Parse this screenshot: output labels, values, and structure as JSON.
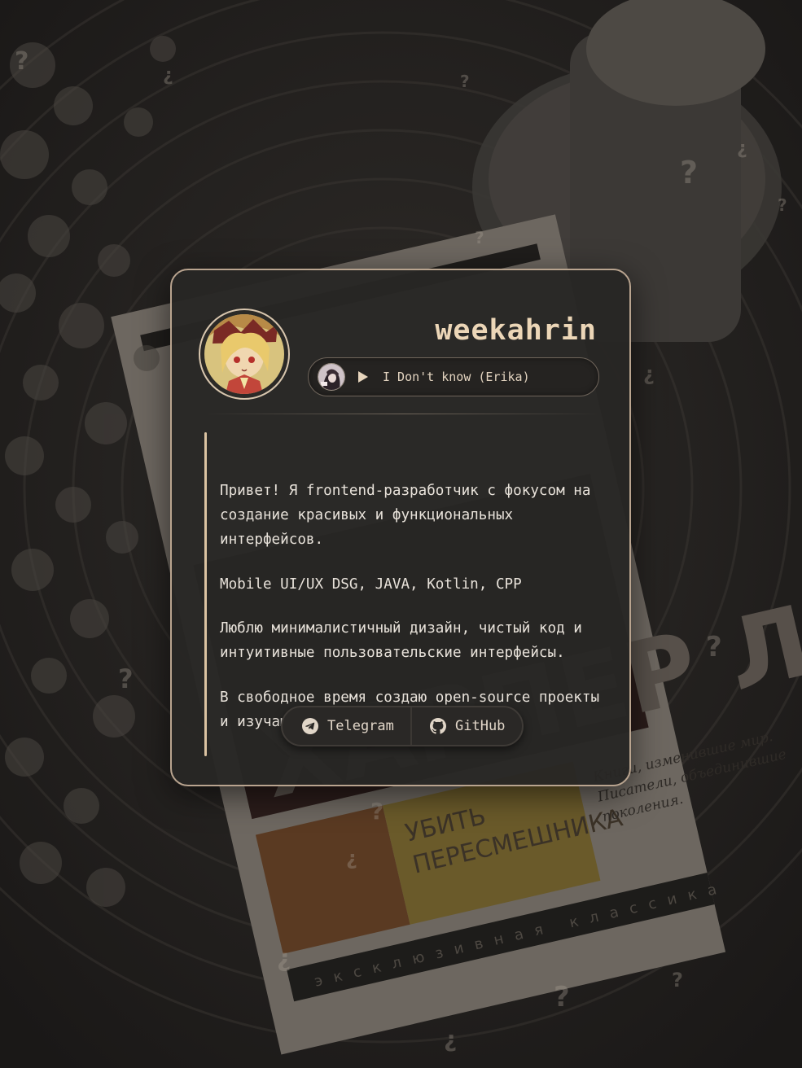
{
  "profile": {
    "username": "weekahrin",
    "avatar_icon": "avatar-anime-character"
  },
  "player": {
    "cover_icon": "album-cover",
    "play_icon": "play-icon",
    "track": "I Don't know (Erika)"
  },
  "bio": [
    "Привет! Я frontend-разработчик с фокусом на\nсоздание красивых и функциональных\nинтерфейсов.",
    "Mobile UI/UX DSG, JAVA, Kotlin, CPP",
    "Люблю минималистичный дизайн, чистый код и\nинтуитивные пользовательские интерфейсы.",
    "В свободное время создаю open-source проекты\nи изучаю новые технологии."
  ],
  "links": {
    "telegram_label": "Telegram",
    "github_label": "GitHub"
  },
  "colors": {
    "accent": "#dbc3a2",
    "card_border": "#b9a48f",
    "username": "#ecd6b7",
    "text": "#e8e2da"
  },
  "background": {
    "book_title": "ХАРПЕР ЛИ",
    "book_subtitle": "УБИТЬ\nПЕРЕСМЕШНИКА",
    "book_tagline": "Книги, изменившие мир.\nПисатели, объединившие\nпоколения.",
    "book_series": "эксклюзивная классика"
  }
}
